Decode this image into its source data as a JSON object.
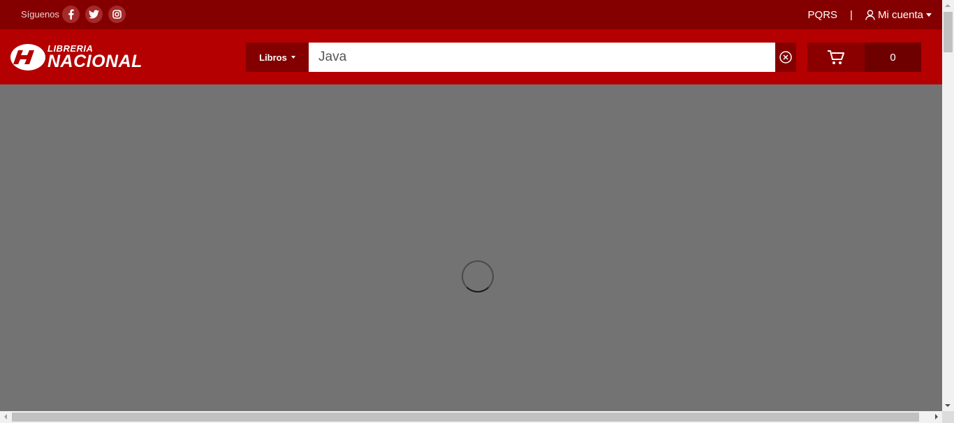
{
  "topbar": {
    "follow_label": "Síguenos",
    "social": [
      "facebook-icon",
      "twitter-icon",
      "instagram-icon"
    ],
    "pqrs_label": "PQRS",
    "separator": "|",
    "account_label": "Mi cuenta"
  },
  "header": {
    "logo_line1": "LIBRERIA",
    "logo_line2": "NACIONAL",
    "category_label": "Libros",
    "search_value": "Java",
    "cart_count": "0"
  },
  "colors": {
    "topbar_bg": "#840000",
    "header_bg": "#b40000",
    "overlay_bg": "#737373"
  }
}
